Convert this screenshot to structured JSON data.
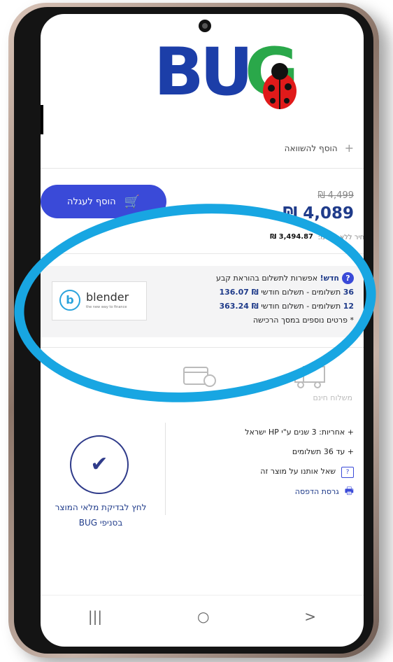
{
  "header": {
    "logo_text": "BUG"
  },
  "actions": {
    "compare_label": "הוסף להשוואה",
    "add_to_cart_label": "הוסף לעגלה"
  },
  "pricing": {
    "old_price": "₪ 4,499",
    "price": "₪ 4,089",
    "vat_label": "מחיר ללא מע\"מ:",
    "price_before_vat": "₪ 3,494.87"
  },
  "financing": {
    "headline_new": "חדש!",
    "headline_rest": "אפשרות לתשלום בהוראת קבע",
    "option_36_prefix": "36",
    "option_36_text": "תשלומים - תשלום חודשי",
    "option_36_amount": "₪ 136.07",
    "option_12_prefix": "12",
    "option_12_text": "תשלומים - תשלום חודשי",
    "option_12_amount": "₪ 363.24",
    "note": "* פרטים נוספים במסך הרכישה",
    "partner_name": "blender",
    "partner_tagline": "the new way to finance"
  },
  "shipping": {
    "free_shipping_label": "משלוח חינם"
  },
  "features": {
    "warranty": "+ אחריות: 3 שנים ע\"י HP ישראל",
    "installments": "+ עד 36 תשלומים",
    "ask_question": "שאל אותנו על מוצר זה",
    "print_version": "גרסת הדפסה"
  },
  "store_check": {
    "line1": "לחץ לבדיקת מלאי המוצר",
    "line2": "בסניפי BUG"
  },
  "navbar": {
    "recents": "|||",
    "home": "○",
    "back": ">"
  },
  "colors": {
    "accent_blue": "#3a4ad8",
    "price_blue": "#1f3b8a",
    "highlight_ring": "#18a6e2"
  }
}
